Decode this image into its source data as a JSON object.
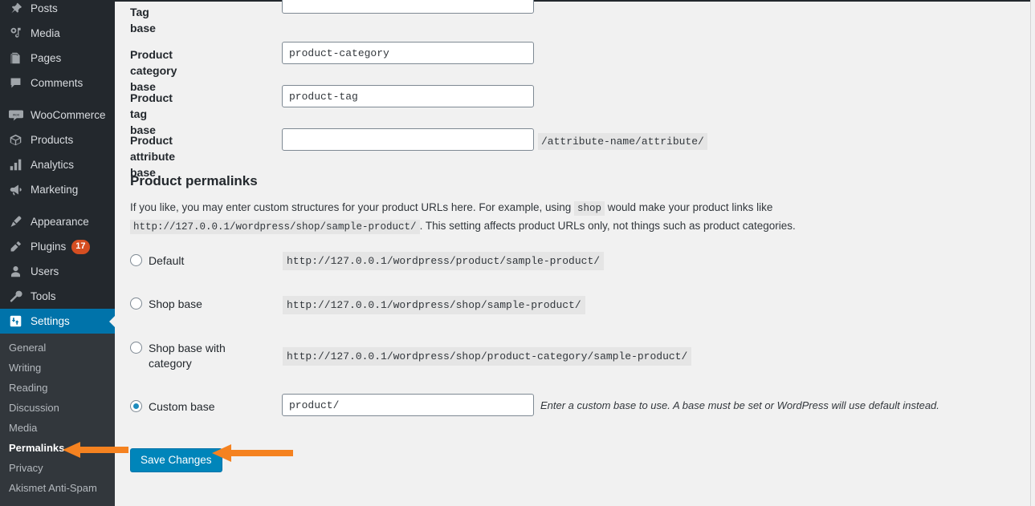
{
  "sidebar": {
    "items": [
      {
        "label": "Posts",
        "icon": "pin-icon",
        "current": false
      },
      {
        "label": "Media",
        "icon": "media-icon",
        "current": false
      },
      {
        "label": "Pages",
        "icon": "pages-icon",
        "current": false
      },
      {
        "label": "Comments",
        "icon": "comments-icon",
        "current": false
      },
      {
        "label": "WooCommerce",
        "icon": "woocommerce-icon",
        "current": false,
        "gap_before": true
      },
      {
        "label": "Products",
        "icon": "products-box-icon",
        "current": false
      },
      {
        "label": "Analytics",
        "icon": "analytics-bars-icon",
        "current": false
      },
      {
        "label": "Marketing",
        "icon": "marketing-megaphone-icon",
        "current": false
      },
      {
        "label": "Appearance",
        "icon": "appearance-brush-icon",
        "current": false,
        "gap_before": true
      },
      {
        "label": "Plugins",
        "icon": "plugins-plug-icon",
        "current": false,
        "badge": "17"
      },
      {
        "label": "Users",
        "icon": "users-icon",
        "current": false
      },
      {
        "label": "Tools",
        "icon": "tools-wrench-icon",
        "current": false
      },
      {
        "label": "Settings",
        "icon": "settings-sliders-icon",
        "current": true
      }
    ],
    "submenu": [
      {
        "label": "General",
        "current": false
      },
      {
        "label": "Writing",
        "current": false
      },
      {
        "label": "Reading",
        "current": false
      },
      {
        "label": "Discussion",
        "current": false
      },
      {
        "label": "Media",
        "current": false
      },
      {
        "label": "Permalinks",
        "current": true
      },
      {
        "label": "Privacy",
        "current": false
      },
      {
        "label": "Akismet Anti-Spam",
        "current": false
      }
    ],
    "colors": {
      "background": "#23282d",
      "submenu_background": "#32373c",
      "current_highlight": "#0073aa",
      "badge": "#d54e21"
    }
  },
  "form": {
    "fields": [
      {
        "label": "Tag base",
        "value": "",
        "placeholder": ""
      },
      {
        "label": "Product category base",
        "value": "product-category",
        "placeholder": ""
      },
      {
        "label": "Product tag base",
        "value": "product-tag",
        "placeholder": ""
      },
      {
        "label": "Product attribute base",
        "value": "",
        "placeholder": "",
        "hint": "/attribute-name/attribute/"
      }
    ]
  },
  "permalinks": {
    "title": "Product permalinks",
    "desc_part1": "If you like, you may enter custom structures for your product URLs here. For example, using",
    "desc_code1": "shop",
    "desc_part2": "would make your product links like",
    "desc_code2": "http://127.0.0.1/wordpress/shop/sample-product/",
    "desc_part3": ". This setting affects product URLs only, not things such as product categories.",
    "options": [
      {
        "label": "Default",
        "url": "http://127.0.0.1/wordpress/product/sample-product/",
        "selected": false
      },
      {
        "label": "Shop base",
        "url": "http://127.0.0.1/wordpress/shop/sample-product/",
        "selected": false
      },
      {
        "label": "Shop base with category",
        "url": "http://127.0.0.1/wordpress/shop/product-category/sample-product/",
        "selected": false
      },
      {
        "label": "Custom base",
        "url": "",
        "selected": true,
        "input_value": "product/",
        "hint": "Enter a custom base to use. A base must be set or WordPress will use default instead."
      }
    ]
  },
  "actions": {
    "save_label": "Save Changes",
    "save_color": "#0085ba"
  },
  "annotations": {
    "arrow_color": "#f58220",
    "arrows": [
      {
        "name": "arrow-to-permalinks",
        "points_to": "Permalinks"
      },
      {
        "name": "arrow-to-save-changes",
        "points_to": "Save Changes"
      }
    ]
  }
}
